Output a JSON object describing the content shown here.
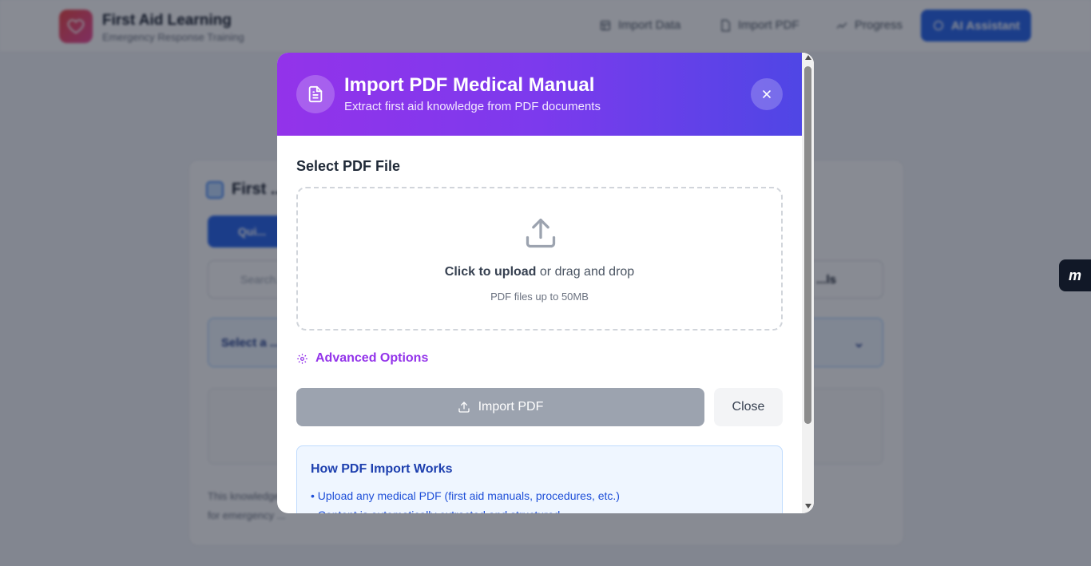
{
  "background": {
    "brand": {
      "title": "First Aid Learning",
      "subtitle": "Emergency Response Training"
    },
    "nav": {
      "import_data": "Import Data",
      "import_pdf": "Import PDF",
      "progress": "Progress",
      "ai_assistant": "AI Assistant"
    },
    "card": {
      "title": "First ...",
      "button_label": "Qui...",
      "search_placeholder": "Search...",
      "search_right": "...ls",
      "select_label": "Select a ...",
      "footer_line1": "This knowledge ...",
      "footer_line2": "for emergency ..."
    }
  },
  "modal": {
    "title": "Import PDF Medical Manual",
    "subtitle": "Extract first aid knowledge from PDF documents",
    "select_label": "Select PDF File",
    "dropzone": {
      "click_text": "Click to upload",
      "rest_text": " or drag and drop",
      "hint": "PDF files up to 50MB"
    },
    "advanced_label": "Advanced Options",
    "import_label": "Import PDF",
    "close_label": "Close",
    "info": {
      "title": "How PDF Import Works",
      "items": [
        "• Upload any medical PDF (first aid manuals, procedures, etc.)",
        "• Content is automatically extracted and structured"
      ]
    }
  },
  "widget": {
    "label": "m"
  },
  "colors": {
    "header_start": "#9333ea",
    "header_end": "#4f46e5",
    "accent": "#9333ea",
    "primary": "#2563eb",
    "disabled": "#9ca3af"
  },
  "icons": [
    "heart-icon",
    "database-icon",
    "file-icon",
    "progress-icon",
    "sparkle-icon",
    "document-icon",
    "close-icon",
    "upload-icon",
    "gear-icon",
    "upload-small-icon"
  ]
}
